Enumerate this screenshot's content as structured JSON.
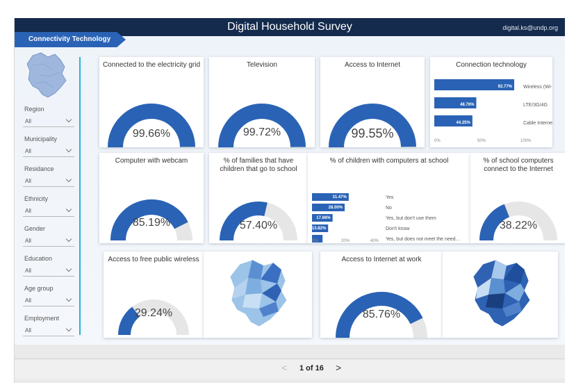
{
  "header": {
    "title": "Digital Household Survey",
    "email": "digital.ks@undp.org",
    "tab_label": "Connectivity Technology"
  },
  "slicers": [
    {
      "label": "Region",
      "value": "All"
    },
    {
      "label": "Municipality",
      "value": "All"
    },
    {
      "label": "Residance",
      "value": "All"
    },
    {
      "label": "Ethnicity",
      "value": "All"
    },
    {
      "label": "Gender",
      "value": "All"
    },
    {
      "label": "Education",
      "value": "All"
    },
    {
      "label": "Age group",
      "value": "All"
    },
    {
      "label": "Employment",
      "value": "All"
    }
  ],
  "gauges": {
    "electricity": {
      "title": "Connected to the electricity grid",
      "value_text": "99.66%",
      "value": 99.66
    },
    "television": {
      "title": "Television",
      "value_text": "99.72%",
      "value": 99.72
    },
    "internet": {
      "title": "Access to Internet",
      "value_text": "99.55%",
      "value": 99.55
    },
    "webcam": {
      "title": "Computer with webcam",
      "value_text": "85.19%",
      "value": 85.19
    },
    "school_families": {
      "title": "% of families that have children that go to school",
      "value_text": "57.40%",
      "value": 57.4
    },
    "school_internet": {
      "title": "% of school computers connect to the Internet",
      "value_text": "38.22%",
      "value": 38.22
    },
    "public_wireless": {
      "title": "Access to free public wireless",
      "value_text": "29.24%",
      "value": 29.24
    },
    "work_internet": {
      "title": "Access to Internet at work",
      "value_text": "85.76%",
      "value": 85.76
    }
  },
  "connection_chart": {
    "title": "Connection technology",
    "categories": [
      "Wireless (Wi-Fi)",
      "LTE/3G/4G",
      "Cable Internet"
    ],
    "values": [
      92.77,
      48.76,
      44.25
    ],
    "value_labels": [
      "92.77%",
      "48.76%",
      "44.25%"
    ],
    "ticks": [
      "0%",
      "50%",
      "100%"
    ]
  },
  "school_chart": {
    "title": "% of children with computers at school",
    "categories": [
      "Yes",
      "No",
      "Yes, but don't use them",
      "Don't know",
      "Yes, but does not meet the need..."
    ],
    "values": [
      31.47,
      28.0,
      17.66,
      13.82,
      9.05
    ],
    "value_labels": [
      "31.47%",
      "28.00%",
      "17.66%",
      "13.82%",
      ""
    ],
    "ticks": [
      "0%",
      "20%",
      "40%"
    ]
  },
  "chart_data": [
    {
      "type": "bar",
      "title": "Connection technology",
      "categories": [
        "Wireless (Wi-Fi)",
        "LTE/3G/4G",
        "Cable Internet"
      ],
      "values": [
        92.77,
        48.76,
        44.25
      ],
      "xlim": [
        0,
        100
      ]
    },
    {
      "type": "bar",
      "title": "% of children with computers at school",
      "categories": [
        "Yes",
        "No",
        "Yes, but don't use them",
        "Don't know",
        "Yes, but does not meet the need..."
      ],
      "values": [
        31.47,
        28.0,
        17.66,
        13.82,
        9.05
      ],
      "xlim": [
        0,
        50
      ]
    }
  ],
  "pager": {
    "page_text": "1 of 16",
    "prev": "<",
    "next": ">"
  },
  "colors": {
    "accent": "#2a63b5",
    "header": "#142b4d",
    "track": "#e6e6e6",
    "map_dark": "#3a6fc1",
    "map_light": "#b8d4ee"
  }
}
